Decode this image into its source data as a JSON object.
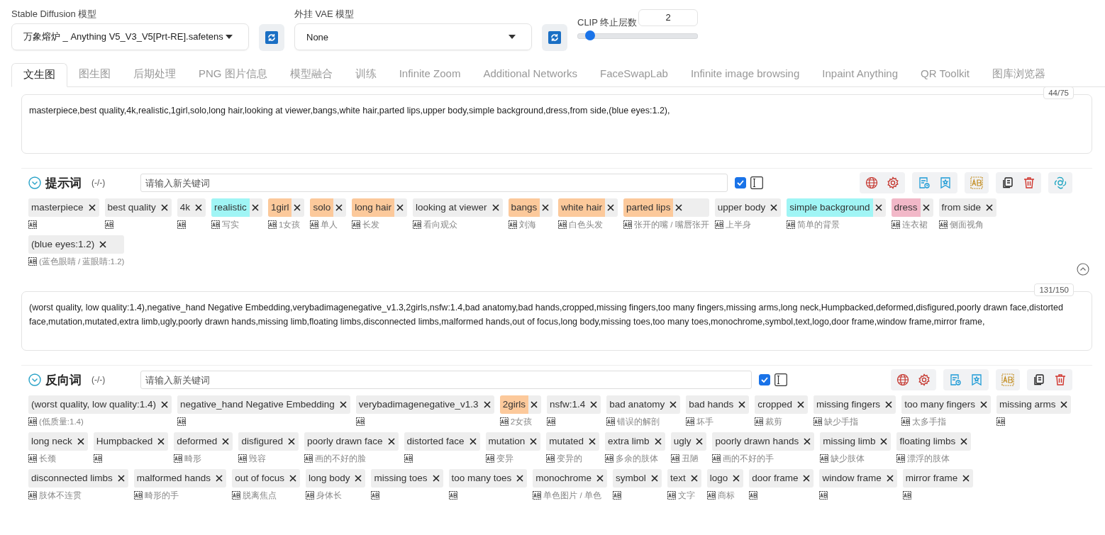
{
  "models": {
    "checkpoint": {
      "label": "Stable Diffusion 模型",
      "value": "万象熔炉 _ Anything V5_V3_V5[Prt-RE].safetens"
    },
    "vae": {
      "label": "外挂 VAE 模型",
      "value": "None"
    },
    "clip": {
      "label": "CLIP 终止层数",
      "value": "2",
      "level": 0.1
    }
  },
  "tabs": [
    {
      "label": "文生图",
      "selected": true
    },
    {
      "label": "图生图",
      "selected": false
    },
    {
      "label": "后期处理",
      "selected": false
    },
    {
      "label": "PNG 图片信息",
      "selected": false
    },
    {
      "label": "模型融合",
      "selected": false
    },
    {
      "label": "训练",
      "selected": false
    },
    {
      "label": "Infinite Zoom",
      "selected": false
    },
    {
      "label": "Additional Networks",
      "selected": false
    },
    {
      "label": "FaceSwapLab",
      "selected": false
    },
    {
      "label": "Infinite image browsing",
      "selected": false
    },
    {
      "label": "Inpaint Anything",
      "selected": false
    },
    {
      "label": "QR Toolkit",
      "selected": false
    },
    {
      "label": "图库浏览器",
      "selected": false
    }
  ],
  "prompts": [
    {
      "text": "masterpiece,best quality,4k,realistic,1girl,solo,long hair,looking at viewer,bangs,white hair,parted lips,upper body,simple background,dress,from side,(blue eyes:1.2),",
      "counter": "44/75",
      "title": "提示词",
      "count": "(-/-)",
      "placeholder": "请输入新关键词",
      "checked": true,
      "ai_button": true,
      "collapse_button": true,
      "tags": [
        {
          "text": "masterpiece",
          "color": "#eeeeee"
        },
        {
          "text": "best quality",
          "color": "#eeeeee"
        },
        {
          "text": "4k",
          "color": "#eeeeee"
        },
        {
          "text": "realistic",
          "color": "#a0f5f5",
          "translation": "写实"
        },
        {
          "text": "1girl",
          "color": "#fcc99b",
          "translation": "1女孩"
        },
        {
          "text": "solo",
          "color": "#fcc99b",
          "translation": "单人"
        },
        {
          "text": "long hair",
          "color": "#fcc99b",
          "translation": "长发"
        },
        {
          "text": "looking at viewer",
          "color": "#eeeeee",
          "translation": "看向观众"
        },
        {
          "text": "bangs",
          "color": "#fcc99b",
          "translation": "刘海"
        },
        {
          "text": "white hair",
          "color": "#fcc99b",
          "translation": "白色头发"
        },
        {
          "text": "parted lips",
          "color": "#fcc99b",
          "translation": "张开的嘴 / 嘴唇张开"
        },
        {
          "text": "upper body",
          "color": "#eeeeee",
          "translation": "上半身"
        },
        {
          "text": "simple background",
          "color": "#a0f5f5",
          "translation": "简单的背景"
        },
        {
          "text": "dress",
          "color": "#f2b8c8",
          "translation": "连衣裙"
        },
        {
          "text": "from side",
          "color": "#eeeeee",
          "translation": "侧面视角"
        },
        {
          "text": "(blue eyes:1.2)",
          "color": "#eeeeee",
          "translation": "(蓝色眼睛 / 蓝眼睛:1.2)"
        }
      ]
    },
    {
      "text": "(worst quality, low quality:1.4),negative_hand Negative Embedding,verybadimagenegative_v1.3,2girls,nsfw:1.4,bad anatomy,bad hands,cropped,missing fingers,too many fingers,missing arms,long neck,Humpbacked,deformed,disfigured,poorly drawn face,distorted face,mutation,mutated,extra limb,ugly,poorly drawn hands,missing limb,floating limbs,disconnected limbs,malformed hands,out of focus,long body,missing toes,too many toes,monochrome,symbol,text,logo,door frame,window frame,mirror frame,",
      "counter": "131/150",
      "title": "反向词",
      "count": "(-/-)",
      "placeholder": "请输入新关键词",
      "checked": true,
      "ai_button": false,
      "collapse_button": false,
      "tags": [
        {
          "text": "(worst quality, low quality:1.4)",
          "color": "#eeeeee",
          "translation": "(低质量:1.4)"
        },
        {
          "text": "negative_hand Negative Embedding",
          "color": "#eeeeee"
        },
        {
          "text": "verybadimagenegative_v1.3",
          "color": "#eeeeee"
        },
        {
          "text": "2girls",
          "color": "#fcc99b",
          "translation": "2女孩"
        },
        {
          "text": "nsfw:1.4",
          "color": "#eeeeee"
        },
        {
          "text": "bad anatomy",
          "color": "#eeeeee",
          "translation": "错误的解剖"
        },
        {
          "text": "bad hands",
          "color": "#eeeeee",
          "translation": "坏手"
        },
        {
          "text": "cropped",
          "color": "#eeeeee",
          "translation": "裁剪"
        },
        {
          "text": "missing fingers",
          "color": "#eeeeee",
          "translation": "缺少手指"
        },
        {
          "text": "too many fingers",
          "color": "#eeeeee",
          "translation": "太多手指"
        },
        {
          "text": "missing arms",
          "color": "#eeeeee"
        },
        {
          "text": "long neck",
          "color": "#eeeeee",
          "translation": "长颈"
        },
        {
          "text": "Humpbacked",
          "color": "#eeeeee"
        },
        {
          "text": "deformed",
          "color": "#eeeeee",
          "translation": "畸形"
        },
        {
          "text": "disfigured",
          "color": "#eeeeee",
          "translation": "毁容"
        },
        {
          "text": "poorly drawn face",
          "color": "#eeeeee",
          "translation": "画的不好的脸"
        },
        {
          "text": "distorted face",
          "color": "#eeeeee"
        },
        {
          "text": "mutation",
          "color": "#eeeeee",
          "translation": "变异"
        },
        {
          "text": "mutated",
          "color": "#eeeeee",
          "translation": "变异的"
        },
        {
          "text": "extra limb",
          "color": "#eeeeee",
          "translation": "多余的肢体"
        },
        {
          "text": "ugly",
          "color": "#eeeeee",
          "translation": "丑陋"
        },
        {
          "text": "poorly drawn hands",
          "color": "#eeeeee",
          "translation": "画的不好的手"
        },
        {
          "text": "missing limb",
          "color": "#eeeeee",
          "translation": "缺少肢体"
        },
        {
          "text": "floating limbs",
          "color": "#eeeeee",
          "translation": "漂浮的肢体"
        },
        {
          "text": "disconnected limbs",
          "color": "#eeeeee",
          "translation": "肢体不连贯"
        },
        {
          "text": "malformed hands",
          "color": "#eeeeee",
          "translation": "畸形的手"
        },
        {
          "text": "out of focus",
          "color": "#eeeeee",
          "translation": "脱离焦点"
        },
        {
          "text": "long body",
          "color": "#eeeeee",
          "translation": "身体长"
        },
        {
          "text": "missing toes",
          "color": "#eeeeee"
        },
        {
          "text": "too many toes",
          "color": "#eeeeee"
        },
        {
          "text": "monochrome",
          "color": "#eeeeee",
          "translation": "单色图片 / 单色"
        },
        {
          "text": "symbol",
          "color": "#eeeeee"
        },
        {
          "text": "text",
          "color": "#eeeeee",
          "translation": "文字"
        },
        {
          "text": "logo",
          "color": "#eeeeee",
          "translation": "商标"
        },
        {
          "text": "door frame",
          "color": "#eeeeee"
        },
        {
          "text": "window frame",
          "color": "#eeeeee"
        },
        {
          "text": "mirror frame",
          "color": "#eeeeee"
        }
      ]
    }
  ]
}
